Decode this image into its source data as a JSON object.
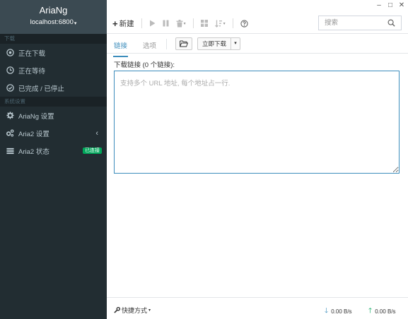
{
  "brand": {
    "title": "AriaNg",
    "host": "localhost:6800"
  },
  "sidebar": {
    "section_download": "下载",
    "section_settings": "系统设置",
    "items": [
      {
        "label": "正在下载",
        "icon": "download-circle-icon"
      },
      {
        "label": "正在等待",
        "icon": "clock-icon"
      },
      {
        "label": "已完成 / 已停止",
        "icon": "check-circle-icon"
      },
      {
        "label": "AriaNg 设置",
        "icon": "gear-icon"
      },
      {
        "label": "Aria2 设置",
        "icon": "gears-icon"
      },
      {
        "label": "Aria2 状态",
        "icon": "server-icon"
      }
    ],
    "status_badge": "已连接"
  },
  "window": {
    "minimize": "–",
    "maximize": "□",
    "close": "✕"
  },
  "toolbar": {
    "new_label": "新建",
    "search_placeholder": "搜索"
  },
  "tabs": {
    "links": "链接",
    "options": "选项"
  },
  "actions": {
    "download_now": "立即下载"
  },
  "form": {
    "label": "下载链接 (0 个链接):",
    "placeholder": "支持多个 URL 地址, 每个地址占一行."
  },
  "footer": {
    "shortcut": "快捷方式",
    "download_speed": "0.00 B/s",
    "upload_speed": "0.00 B/s"
  },
  "colors": {
    "sidebar_bg": "#222d32",
    "brand_bg": "#3b4a52",
    "accent": "#3c8dbc",
    "success": "#00a65a"
  }
}
